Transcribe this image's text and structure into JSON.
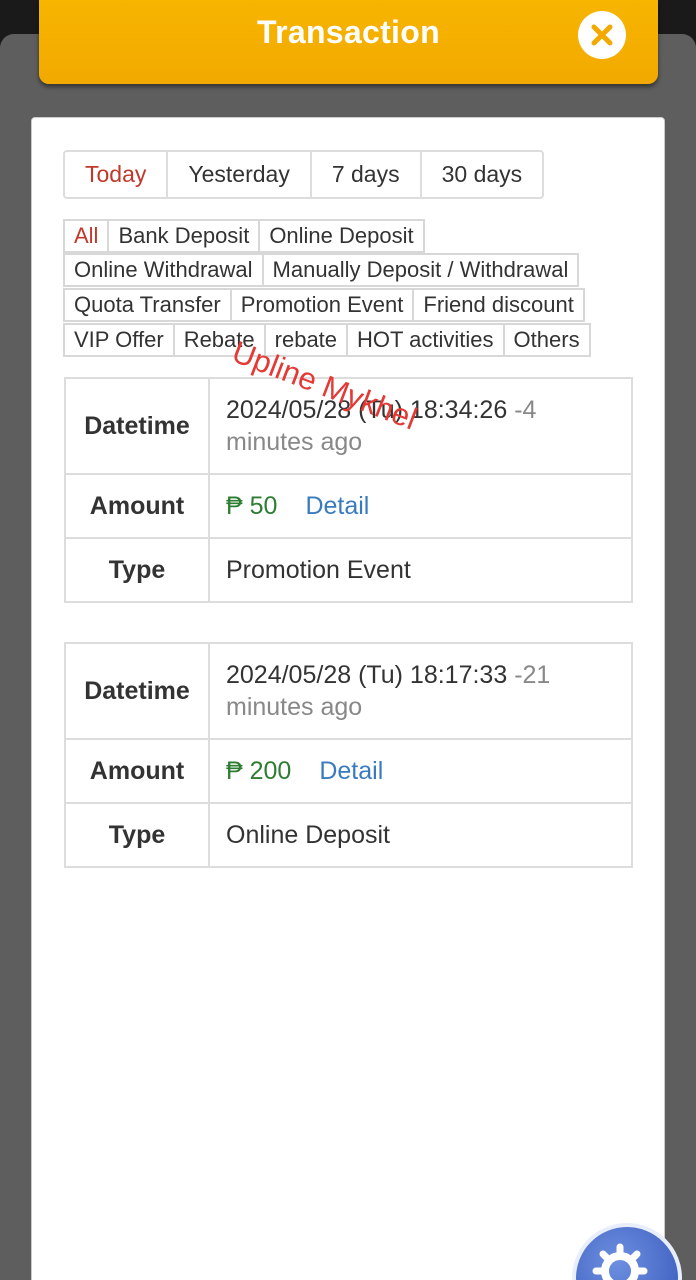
{
  "header": {
    "title": "Transaction",
    "close_icon": "close-icon"
  },
  "date_tabs": [
    {
      "label": "Today",
      "active": true
    },
    {
      "label": "Yesterday",
      "active": false
    },
    {
      "label": "7 days",
      "active": false
    },
    {
      "label": "30 days",
      "active": false
    }
  ],
  "type_filters": {
    "row1": [
      "All",
      "Bank Deposit",
      "Online Deposit"
    ],
    "row2": [
      "Online Withdrawal",
      "Manually Deposit / Withdrawal"
    ],
    "row3": [
      "Quota Transfer",
      "Promotion Event",
      "Friend discount"
    ],
    "row4": [
      "VIP Offer",
      "Rebate",
      "rebate",
      "HOT activities",
      "Others"
    ],
    "active": "All"
  },
  "watermark": "Upline Mykhel",
  "transactions": [
    {
      "datetime_label": "Datetime",
      "datetime": "2024/05/28 (Tu) 18:34:26",
      "ago": "-4 minutes ago",
      "amount_label": "Amount",
      "amount": "₱ 50",
      "detail": "Detail",
      "type_label": "Type",
      "type": "Promotion Event"
    },
    {
      "datetime_label": "Datetime",
      "datetime": "2024/05/28 (Tu) 18:17:33",
      "ago": "-21 minutes ago",
      "amount_label": "Amount",
      "amount": "₱ 200",
      "detail": "Detail",
      "type_label": "Type",
      "type": "Online Deposit"
    }
  ],
  "colors": {
    "header": "#f2a900",
    "active_tab": "#c0392b",
    "amount": "#2e7d32",
    "link": "#3a7bbf",
    "watermark": "#e53935"
  },
  "fab": {
    "icon": "gear-icon"
  }
}
